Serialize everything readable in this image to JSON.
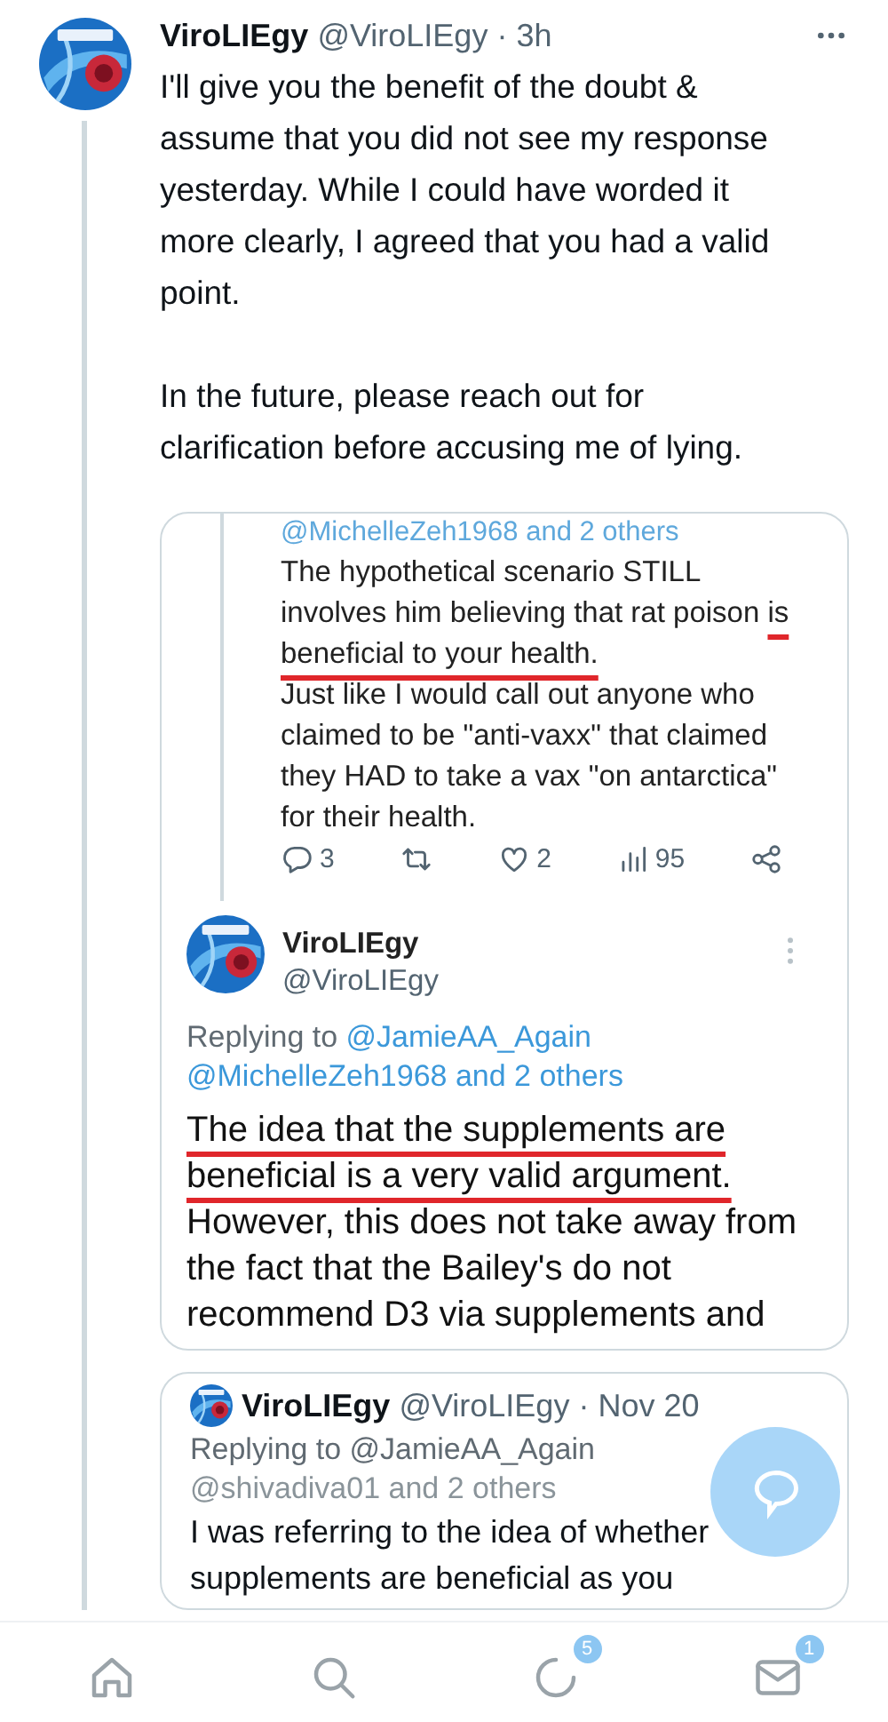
{
  "tweet": {
    "name": "ViroLIEgy",
    "handle": "@ViroLIEgy",
    "separator": "·",
    "time": "3h",
    "paragraphs": [
      "I'll give you the benefit of the doubt & assume that you did not see my response yesterday. While I could have worded it more clearly, I agreed that you had a valid point.",
      "In the future, please reach out for clarification before accusing me of lying."
    ]
  },
  "screenshot": {
    "cut_mentions": "@MichelleZeh1968 and 2 others",
    "paragraphs": [
      {
        "segments": [
          {
            "text": "The hypothetical scenario STILL involves him believing that rat poison ",
            "underlined": false
          },
          {
            "text": "is beneficial to your health.",
            "underlined": true
          }
        ]
      },
      {
        "segments": [
          {
            "text": "Just like I would call out anyone who claimed to be \"anti-vaxx\" that claimed they HAD to take a vax \"on antarctica\" for their health.",
            "underlined": false
          }
        ]
      }
    ],
    "actions": [
      {
        "kind": "reply",
        "count": "3"
      },
      {
        "kind": "retweet"
      },
      {
        "kind": "like",
        "count": "2"
      },
      {
        "kind": "views",
        "count": "95"
      },
      {
        "kind": "share"
      }
    ],
    "reply": {
      "name": "ViroLIEgy",
      "handle": "@ViroLIEgy",
      "replying_label": "Replying to",
      "replying_to": "@JamieAA_Again",
      "mentions": "@MichelleZeh1968 and 2 others",
      "segments": [
        {
          "text": "The idea that the supplements are beneficial is a very valid argument.",
          "underlined": true
        },
        {
          "text": " However, this does not take away from the fact that the Bailey's do not recommend D3 via supplements and",
          "underlined": false
        }
      ]
    }
  },
  "quote": {
    "name": "ViroLIEgy",
    "handle": "@ViroLIEgy",
    "separator": "·",
    "time": "Nov 20",
    "replying_label": "Replying to",
    "replying_to": "@JamieAA_Again",
    "mentions": "@shivadiva01 and 2 others",
    "text": "I was referring to the idea of whether supplements are beneficial as you"
  },
  "nav": [
    {
      "kind": "home"
    },
    {
      "kind": "search"
    },
    {
      "kind": "communities",
      "badge": "5"
    },
    {
      "kind": "messages",
      "badge": "1"
    }
  ]
}
